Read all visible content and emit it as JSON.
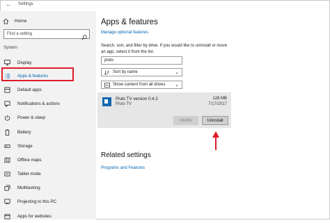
{
  "window": {
    "title": "Settings",
    "back_glyph": "←"
  },
  "sidebar": {
    "home_label": "Home",
    "search_placeholder": "Find a setting",
    "section_title": "System",
    "items": [
      {
        "label": "Display",
        "icon": "display-icon"
      },
      {
        "label": "Apps & features",
        "icon": "apps-list-icon",
        "active": true
      },
      {
        "label": "Default apps",
        "icon": "default-apps-icon"
      },
      {
        "label": "Notifications & actions",
        "icon": "notifications-icon"
      },
      {
        "label": "Power & sleep",
        "icon": "power-icon"
      },
      {
        "label": "Battery",
        "icon": "battery-icon"
      },
      {
        "label": "Storage",
        "icon": "storage-icon"
      },
      {
        "label": "Offline maps",
        "icon": "map-icon"
      },
      {
        "label": "Tablet mode",
        "icon": "tablet-icon"
      },
      {
        "label": "Multitasking",
        "icon": "multitasking-icon"
      },
      {
        "label": "Projecting to this PC",
        "icon": "projecting-icon"
      },
      {
        "label": "Apps for websites",
        "icon": "apps-websites-icon"
      }
    ]
  },
  "main": {
    "title": "Apps & features",
    "manage_link": "Manage optional features",
    "description": "Search, sort, and filter by drive. If you would like to uninstall or move an app, select it from the list.",
    "search_value": "pluto",
    "sort_label": "Sort by name",
    "filter_label": "Show content from all drives",
    "app": {
      "name": "Pluto TV version 0.4.2",
      "publisher": "Pluto TV",
      "size": "128 MB",
      "date": "7/17/2017",
      "modify_label": "Modify",
      "uninstall_label": "Uninstall"
    },
    "related_title": "Related settings",
    "programs_link": "Programs and Features"
  },
  "colors": {
    "accent": "#0063b1",
    "annotation": "#e01a2b",
    "sidebar_bg": "#f2f2f2",
    "app_icon": "#1568b0"
  }
}
